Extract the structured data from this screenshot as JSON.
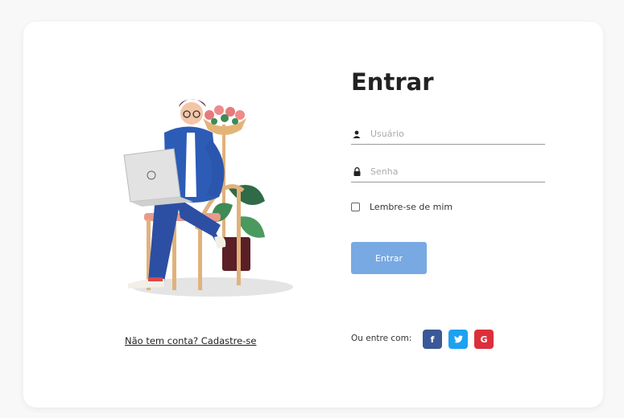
{
  "login": {
    "title": "Entrar",
    "username_placeholder": "Usuário",
    "password_placeholder": "Senha",
    "remember_label": "Lembre-se de mim",
    "submit_label": "Entrar",
    "social_label": "Ou entre com:"
  },
  "signup": {
    "link_text": "Não tem conta? Cadastre-se"
  },
  "social": {
    "facebook_glyph": "f",
    "google_glyph": "G",
    "icons": [
      "facebook-icon",
      "twitter-icon",
      "google-icon"
    ]
  },
  "colors": {
    "button": "#78a9e2",
    "facebook": "#3b5998",
    "twitter": "#1da1f2",
    "google": "#dc2f3b"
  }
}
